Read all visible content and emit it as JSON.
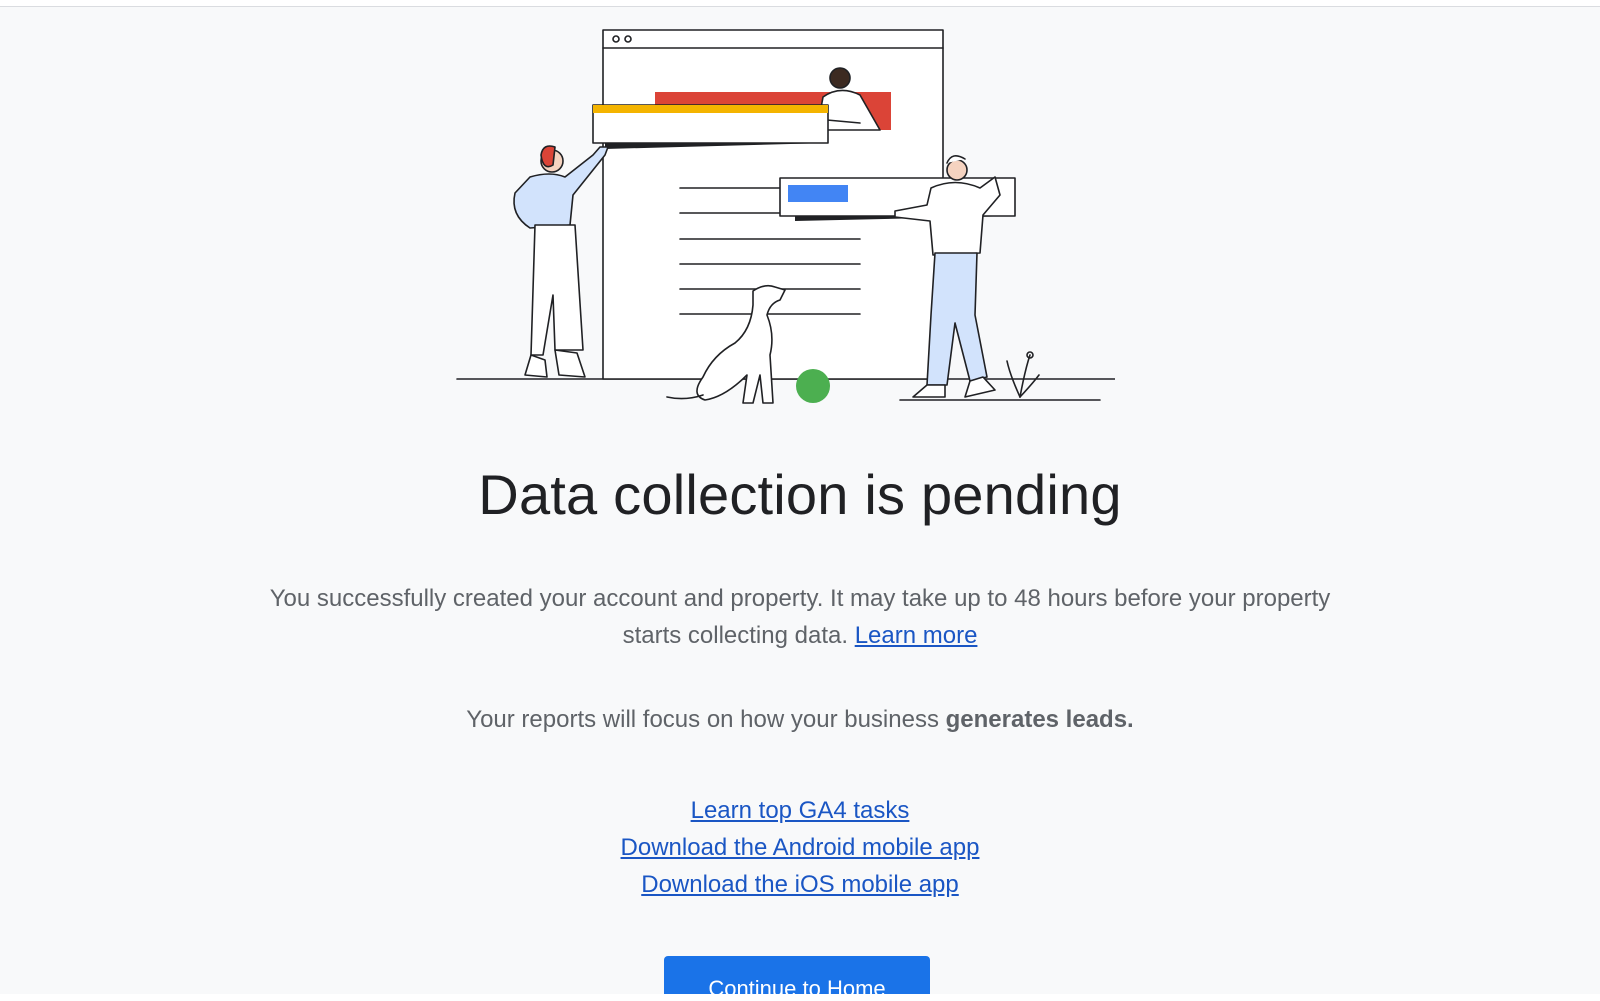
{
  "page": {
    "title": "Data collection is pending",
    "description": "You successfully created your account and property. It may take up to 48 hours before your property starts collecting data.",
    "learn_more": "Learn more",
    "focus_prefix": "Your reports will focus on how your business",
    "focus_bold": "generates leads.",
    "links": {
      "ga4_tasks": "Learn top GA4 tasks",
      "android_app": "Download the Android mobile app",
      "ios_app": "Download the iOS mobile app"
    },
    "continue_button": "Continue to Home"
  },
  "colors": {
    "accent": "#1a73e8",
    "link": "#1a56c4",
    "title": "#202124",
    "body_text": "#5f6368",
    "background": "#f8f9fa",
    "illustration_yellow": "#f4b400",
    "illustration_red": "#db4437",
    "illustration_blue": "#4285f4",
    "illustration_green": "#4caf50",
    "illustration_lavender": "#d2e3fc"
  },
  "illustration": {
    "subject": "team-building-report-illustration"
  }
}
